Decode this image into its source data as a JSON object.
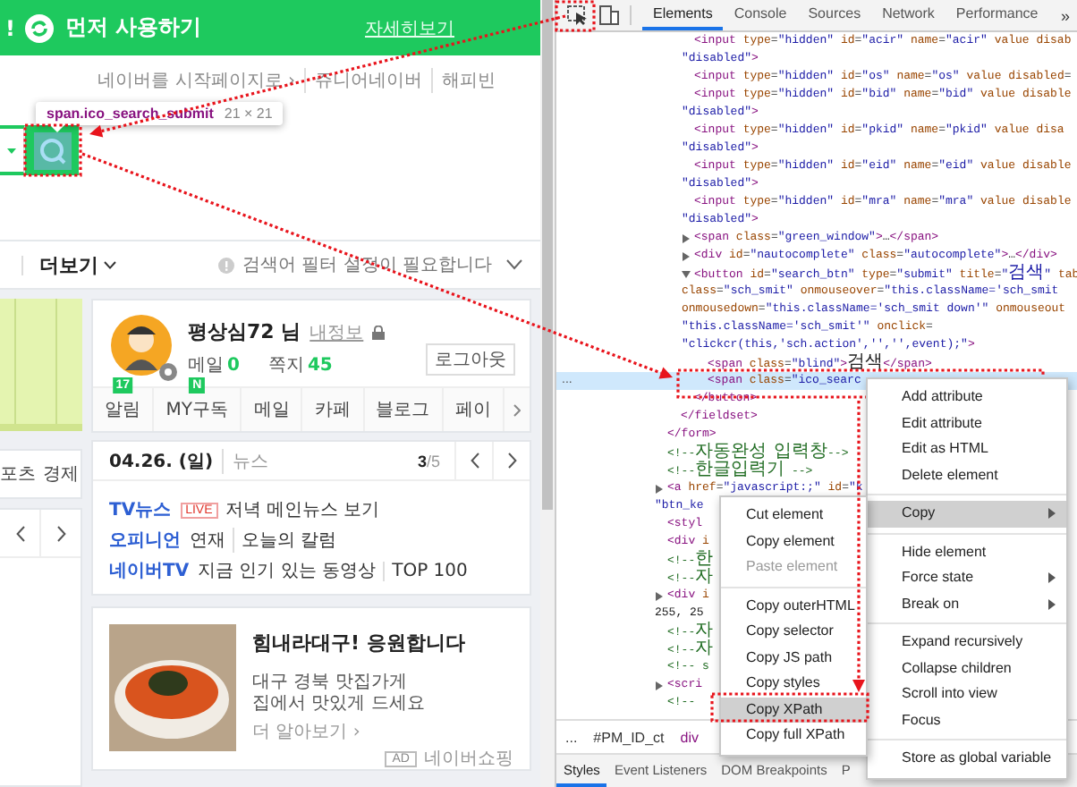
{
  "page": {
    "banner": {
      "alert": "!",
      "title": "먼저 사용하기",
      "link": "자세히보기"
    },
    "top_links": [
      "네이버를 시작페이지로 ›",
      "쥬니어네이버",
      "해피빈"
    ],
    "inspect_tooltip": {
      "selector": "span.ico_search_submit",
      "size": "21 × 21"
    },
    "filter_bar": {
      "more": "더보기",
      "notice": "검색어 필터 설정이 필요합니다"
    },
    "side_column": {
      "categories": [
        "포츠",
        "경제"
      ]
    },
    "profile": {
      "name": "평상심72 님",
      "info_link": "내정보",
      "mail_label": "메일",
      "mail_count": "0",
      "note_label": "쪽지",
      "note_count": "45",
      "logout": "로그아웃",
      "shortcuts": [
        {
          "label": "알림",
          "badge": "17"
        },
        {
          "label": "MY구독",
          "badge": "N"
        },
        {
          "label": "메일"
        },
        {
          "label": "카페"
        },
        {
          "label": "블로그"
        },
        {
          "label": "페이"
        }
      ]
    },
    "news": {
      "date": "04.26. (일)",
      "section": "뉴스",
      "pager": "**3**/5",
      "lines": [
        {
          "source": "TV뉴스",
          "badge": "LIVE",
          "items": [
            "저녁 메인뉴스 보기"
          ]
        },
        {
          "source": "오피니언",
          "items": [
            "연재",
            "오늘의 칼럼"
          ]
        },
        {
          "source": "네이버TV",
          "items": [
            "지금 인기 있는 동영상",
            "TOP 100"
          ]
        }
      ]
    },
    "ad": {
      "title": "힘내라대구! 응원합니다",
      "lines": [
        "대구 경북 맛집가게",
        "집에서 맛있게 드세요"
      ],
      "more": "더 알아보기 ›",
      "ad_label": "AD",
      "advertiser": "네이버쇼핑"
    }
  },
  "devtools": {
    "tabs": [
      {
        "label": "Elements",
        "selected": true
      },
      {
        "label": "Console",
        "selected": false
      },
      {
        "label": "Sources",
        "selected": false
      },
      {
        "label": "Network",
        "selected": false
      },
      {
        "label": "Performance",
        "selected": false
      }
    ],
    "overflow": "»",
    "dom_tree": [
      {
        "children": [
          {
            "children": [
              {
                "lines": [
                  "<input type=\"hidden\" id=\"acir\" name=\"acir\" value disab",
                  "\"disabled\">"
                ],
                "selected": false
              },
              {
                "lines": [
                  "<input type=\"hidden\" id=\"os\" name=\"os\" value disabled="
                ],
                "selected": false
              },
              {
                "lines": [
                  "<input type=\"hidden\" id=\"bid\" name=\"bid\" value disable",
                  "\"disabled\">"
                ],
                "selected": false
              },
              {
                "lines": [
                  "<input type=\"hidden\" id=\"pkid\" name=\"pkid\" value disa",
                  "\"disabled\">"
                ],
                "selected": false
              },
              {
                "lines": [
                  "<input type=\"hidden\" id=\"eid\" name=\"eid\" value disable",
                  "\"disabled\">"
                ],
                "selected": false
              },
              {
                "lines": [
                  "<input type=\"hidden\" id=\"mra\" name=\"mra\" value disable",
                  "\"disabled\">"
                ],
                "selected": false
              },
              {
                "lines": [
                  "<span class=\"green_window\">…</span>"
                ],
                "expanded": false,
                "selected": false
              },
              {
                "lines": [
                  "<div id=\"nautocomplete\" class=\"autocomplete\">…</div>"
                ],
                "expanded": false,
                "selected": false
              },
              {
                "lines": [
                  "<button id=\"search_btn\" type=\"submit\" title=\"검색\" tab",
                  "class=\"sch_smit\" onmouseover=\"this.className='sch_smit",
                  "onmousedown=\"this.className='sch_smit down'\" onmouseout",
                  "\"this.className='sch_smit'\" onclick=",
                  "\"clickcr(this,'sch.action','','',event);\">"
                ],
                "expanded": true,
                "selected": false,
                "children": [
                  {
                    "lines": [
                      "<span class=\"blind\">검색</span>"
                    ],
                    "selected": false
                  },
                  {
                    "lines": [
                      "<span class=\"ico_searc"
                    ],
                    "selected": true
                  }
                ],
                "closing": "</button>"
              }
            ],
            "closing": "</fieldset>"
          }
        ],
        "closing": "</form>"
      },
      {
        "lines": [
          "<!--자동완성 입력창-->"
        ],
        "selected": false
      },
      {
        "lines": [
          "<!--한글입력기 -->"
        ],
        "selected": false
      },
      {
        "lines": [
          "<a href=\"javascript:;\" id=\"k",
          "\"btn_ke"
        ],
        "expanded": false,
        "selected": false
      },
      {
        "lines": [
          "<styl"
        ],
        "selected": false
      },
      {
        "lines": [
          "<div i"
        ],
        "selected": false
      },
      {
        "lines": [
          "<!--한"
        ],
        "selected": false
      },
      {
        "lines": [
          "<!--자"
        ],
        "selected": false
      },
      {
        "lines": [
          "<div i",
          "255, 25"
        ],
        "expanded": false,
        "selected": false
      },
      {
        "lines": [
          "<!--자"
        ],
        "selected": false
      },
      {
        "lines": [
          "<!--자"
        ],
        "selected": false
      },
      {
        "lines": [
          "<!-- s"
        ],
        "selected": false
      },
      {
        "lines": [
          "<scri"
        ],
        "expanded": false,
        "selected": false
      },
      {
        "lines": [
          "<!--"
        ],
        "selected": false
      }
    ],
    "selected_row_marker": "...",
    "breadcrumbs": [
      "...",
      "#PM_ID_ct",
      "div"
    ],
    "panel_tabs": [
      {
        "label": "Styles",
        "selected": true
      },
      {
        "label": "Event Listeners",
        "selected": false
      },
      {
        "label": "DOM Breakpoints",
        "selected": false
      },
      {
        "label": "P",
        "selected": false
      }
    ],
    "context_menu": {
      "groups": [
        {
          "items": [
            {
              "label": "Add attribute",
              "selected": false,
              "submenu": false
            },
            {
              "label": "Edit attribute",
              "selected": false,
              "submenu": false
            },
            {
              "label": "Edit as HTML",
              "selected": false,
              "submenu": false
            },
            {
              "label": "Delete element",
              "selected": false,
              "submenu": false
            }
          ]
        },
        {
          "items": [
            {
              "label": "Copy",
              "selected": true,
              "submenu": true
            }
          ]
        },
        {
          "items": [
            {
              "label": "Hide element",
              "selected": false,
              "submenu": false
            },
            {
              "label": "Force state",
              "selected": false,
              "submenu": true
            },
            {
              "label": "Break on",
              "selected": false,
              "submenu": true
            }
          ]
        },
        {
          "items": [
            {
              "label": "Expand recursively",
              "selected": false,
              "submenu": false
            },
            {
              "label": "Collapse children",
              "selected": false,
              "submenu": false
            },
            {
              "label": "Scroll into view",
              "selected": false,
              "submenu": false
            },
            {
              "label": "Focus",
              "selected": false,
              "submenu": false
            }
          ]
        },
        {
          "items": [
            {
              "label": "Store as global variable",
              "selected": false,
              "submenu": false
            }
          ]
        }
      ]
    },
    "copy_submenu": {
      "groups": [
        {
          "items": [
            {
              "label": "Cut element",
              "selected": false,
              "disabled": false
            },
            {
              "label": "Copy element",
              "selected": false,
              "disabled": false
            },
            {
              "label": "Paste element",
              "selected": false,
              "disabled": true
            }
          ]
        },
        {
          "items": [
            {
              "label": "Copy outerHTML",
              "selected": false,
              "disabled": false
            },
            {
              "label": "Copy selector",
              "selected": false,
              "disabled": false
            },
            {
              "label": "Copy JS path",
              "selected": false,
              "disabled": false
            },
            {
              "label": "Copy styles",
              "selected": false,
              "disabled": false
            },
            {
              "label": "Copy XPath",
              "selected": true,
              "disabled": false
            },
            {
              "label": "Copy full XPath",
              "selected": false,
              "disabled": false
            }
          ]
        }
      ]
    }
  }
}
